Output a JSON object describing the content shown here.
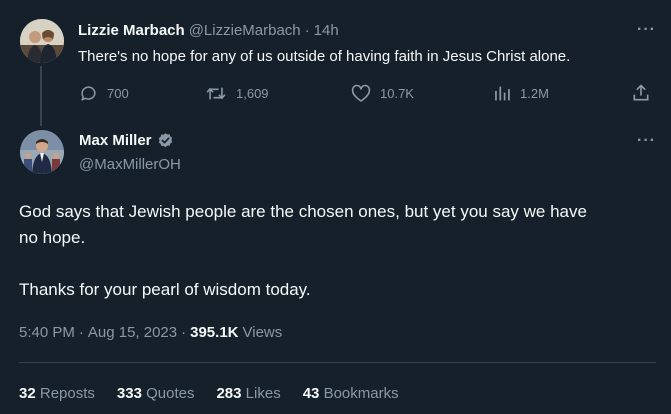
{
  "reply_to": {
    "author_name": "Lizzie Marbach",
    "handle": "@LizzieMarbach",
    "separator": "·",
    "age": "14h",
    "text": "There's no hope for any of us outside of having faith in Jesus Christ alone.",
    "actions": {
      "replies": "700",
      "reposts": "1,609",
      "likes": "10.7K",
      "views": "1.2M"
    }
  },
  "tweet": {
    "author_name": "Max Miller",
    "handle": "@MaxMillerOH",
    "verified": true,
    "paragraph_1": "God says that Jewish people are the chosen ones, but yet you say we have",
    "paragraph_1b": "no hope.",
    "paragraph_2": "Thanks for your pearl of wisdom today.",
    "time": "5:40 PM",
    "dot": "·",
    "date": "Aug 15, 2023",
    "view_count": "395.1K",
    "views_label": "Views"
  },
  "stats": [
    {
      "count": "32",
      "label": "Reposts"
    },
    {
      "count": "333",
      "label": "Quotes"
    },
    {
      "count": "283",
      "label": "Likes"
    },
    {
      "count": "43",
      "label": "Bookmarks"
    }
  ],
  "more_glyph": "···",
  "colors": {
    "background": "#15202b",
    "text": "#f7f9f9",
    "muted": "#8b98a5",
    "divider": "#38444d"
  }
}
